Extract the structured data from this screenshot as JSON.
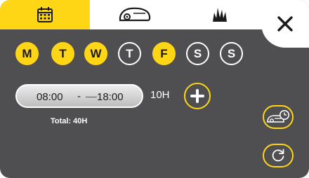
{
  "tabs": [
    {
      "icon": "calendar-icon",
      "active": true
    },
    {
      "icon": "mower-icon",
      "active": false
    },
    {
      "icon": "grass-icon",
      "active": false
    }
  ],
  "close_icon": "close-icon",
  "days": [
    {
      "label": "M",
      "selected": true
    },
    {
      "label": "T",
      "selected": true
    },
    {
      "label": "W",
      "selected": true
    },
    {
      "label": "T",
      "selected": false
    },
    {
      "label": "F",
      "selected": true
    },
    {
      "label": "S",
      "selected": false
    },
    {
      "label": "S",
      "selected": false
    }
  ],
  "schedule": {
    "start": "08:00",
    "separator": "-",
    "end": "18:00",
    "duration": "10H"
  },
  "total": "Total: 40H",
  "side_buttons": [
    "mower-schedule-icon",
    "refresh-icon"
  ],
  "colors": {
    "accent": "#ffd615",
    "panel": "#4f4f51",
    "text_light": "#ffffff"
  }
}
